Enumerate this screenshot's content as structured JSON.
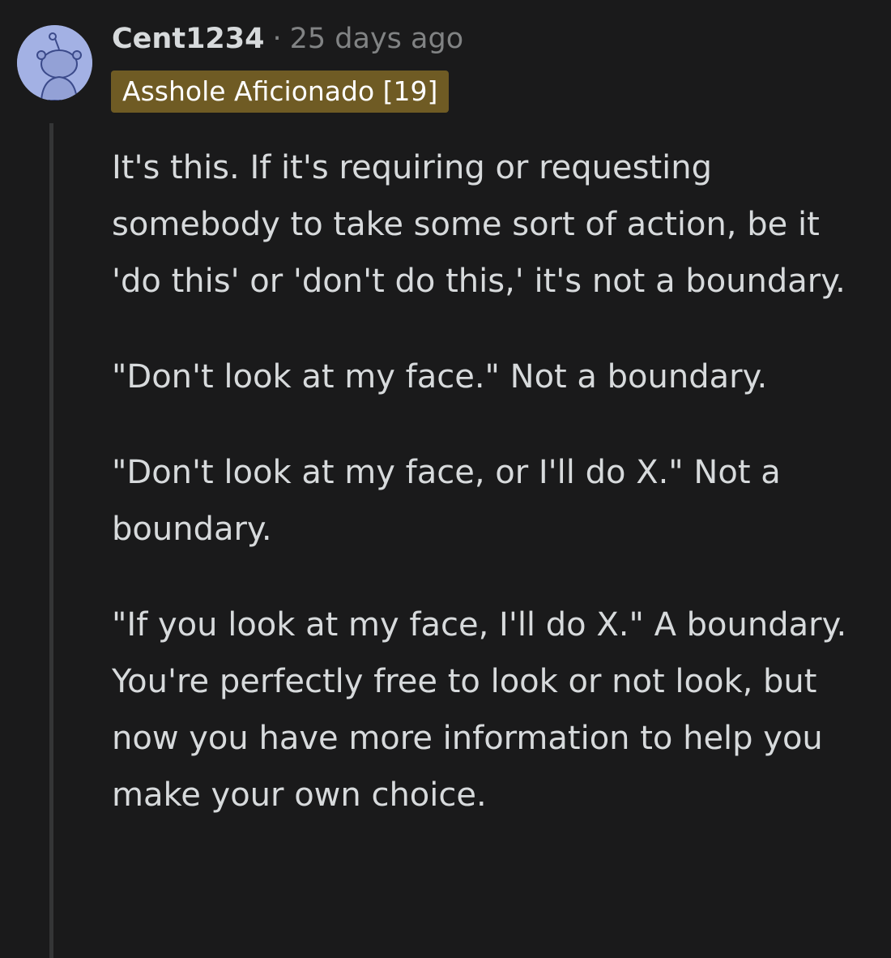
{
  "comment": {
    "author": "Cent1234",
    "separator": "·",
    "timestamp": "25 days ago",
    "flair": "Asshole Aficionado [19]",
    "avatar_icon": "snoo-avatar-icon",
    "colors": {
      "background": "#1a1a1b",
      "text": "#d7dadc",
      "muted": "#818384",
      "flair_bg": "#6f5b24",
      "avatar_bg": "#a3b1e4",
      "thread_line": "#343536"
    },
    "paragraphs": [
      "It's this. If it's requiring or requesting somebody to take some sort of action, be it 'do this' or 'don't do this,' it's not a boundary.",
      "\"Don't look at my face.\" Not a boundary.",
      "\"Don't look at my face, or I'll do X.\" Not a boundary.",
      "\"If you look at my face, I'll do X.\" A boundary. You're perfectly free to look or not look, but now you have more information to help you make your own choice."
    ]
  }
}
